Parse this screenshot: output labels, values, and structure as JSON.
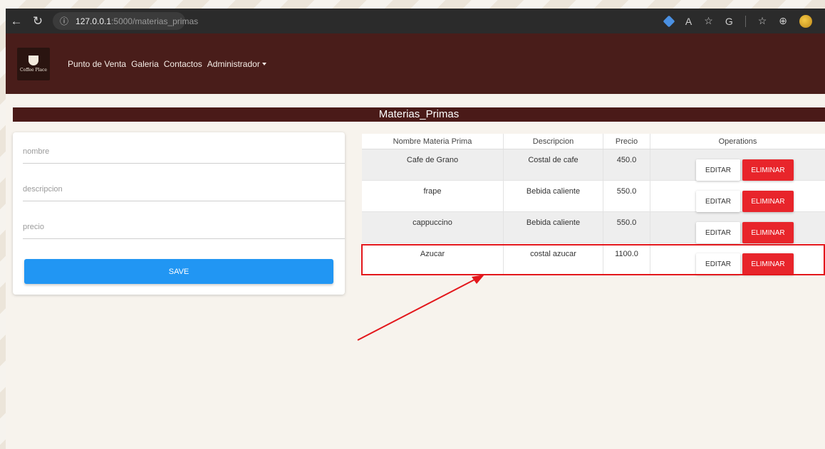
{
  "browser": {
    "url_host": "127.0.0.1",
    "url_rest": ":5000/materias_primas"
  },
  "navbar": {
    "logo_text": "Coffee Place",
    "links": [
      "Punto de Venta",
      "Galeria",
      "Contactos",
      "Administrador"
    ]
  },
  "page_title": "Materias_Primas",
  "form": {
    "nombre_placeholder": "nombre",
    "descripcion_placeholder": "descripcion",
    "precio_placeholder": "precio",
    "save_label": "SAVE"
  },
  "table": {
    "headers": [
      "Nombre Materia Prima",
      "Descripcion",
      "Precio",
      "Operations"
    ],
    "rows": [
      {
        "nombre": "Cafe de Grano",
        "descripcion": "Costal de cafe",
        "precio": "450.0"
      },
      {
        "nombre": "frape",
        "descripcion": "Bebida caliente",
        "precio": "550.0"
      },
      {
        "nombre": "cappuccino",
        "descripcion": "Bebida caliente",
        "precio": "550.0"
      },
      {
        "nombre": "Azucar",
        "descripcion": "costal azucar",
        "precio": "1100.0"
      }
    ],
    "edit_label": "EDITAR",
    "delete_label": "ELIMINAR"
  },
  "colors": {
    "navbar": "#491d1a",
    "save_button": "#2196f3",
    "delete_button": "#e8252b",
    "annotation": "#e3171c"
  }
}
